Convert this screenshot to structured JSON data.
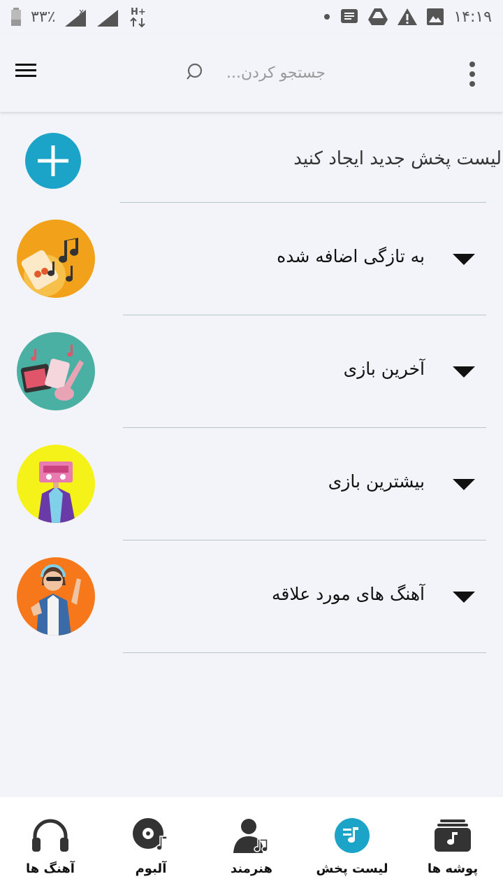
{
  "status_bar": {
    "battery_percent": "۳۳٪",
    "time": "۱۴:۱۹",
    "network_label": "H+"
  },
  "app_bar": {
    "search_placeholder": "جستجو کردن..."
  },
  "create_playlist": {
    "label": "لیست پخش جدید ایجاد کنید",
    "button_color": "#1ba4c8"
  },
  "playlists": [
    {
      "title": "به تازگی اضافه شده",
      "thumb_color": "#f2a21a"
    },
    {
      "title": "آخرین بازی",
      "thumb_color": "#4bb0a4"
    },
    {
      "title": "بیشترین بازی",
      "thumb_color": "#f5f21a"
    },
    {
      "title": "آهنگ های مورد علاقه",
      "thumb_color": "#f7781a"
    }
  ],
  "bottom_nav": {
    "active_color": "#1ba4c8",
    "items": [
      {
        "label": "آهنگ ها",
        "icon": "headphones-icon"
      },
      {
        "label": "آلبوم",
        "icon": "album-disc-icon"
      },
      {
        "label": "هنرمند",
        "icon": "artist-icon"
      },
      {
        "label": "لیست پخش",
        "icon": "playlist-icon",
        "active": true
      },
      {
        "label": "پوشه ها",
        "icon": "folder-music-icon"
      }
    ]
  }
}
